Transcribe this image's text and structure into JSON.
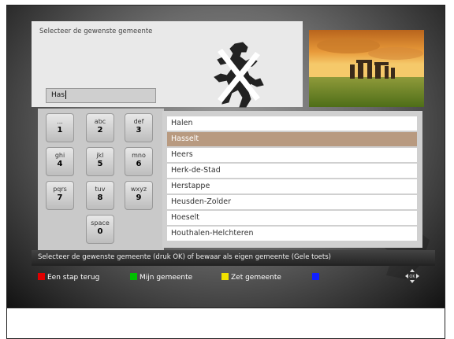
{
  "prompt": "Selecteer de gewenste gemeente",
  "search": {
    "value": "Has"
  },
  "keypad": [
    {
      "letters": "...",
      "digit": "1"
    },
    {
      "letters": "abc",
      "digit": "2"
    },
    {
      "letters": "def",
      "digit": "3"
    },
    {
      "letters": "ghi",
      "digit": "4"
    },
    {
      "letters": "jkl",
      "digit": "5"
    },
    {
      "letters": "mno",
      "digit": "6"
    },
    {
      "letters": "pqrs",
      "digit": "7"
    },
    {
      "letters": "tuv",
      "digit": "8"
    },
    {
      "letters": "wxyz",
      "digit": "9"
    },
    {
      "letters": "space",
      "digit": "0"
    }
  ],
  "list": {
    "items": [
      "Halen",
      "Hasselt",
      "Heers",
      "Herk-de-Stad",
      "Herstappe",
      "Heusden-Zolder",
      "Hoeselt",
      "Houthalen-Helchteren"
    ],
    "selected_index": 1
  },
  "status": "Selecteer de gewenste gemeente (druk OK) of bewaar als eigen gemeente (Gele toets)",
  "legend": [
    {
      "color": "#e00000",
      "label": "Een stap terug"
    },
    {
      "color": "#00c000",
      "label": "Mijn gemeente"
    },
    {
      "color": "#f0e000",
      "label": "Zet gemeente"
    },
    {
      "color": "#1020ff",
      "label": ""
    }
  ],
  "icons": {
    "crest": "flemish-lion-crest",
    "photo": "stonehenge-photo",
    "nav": "arrows-nav-icon"
  }
}
